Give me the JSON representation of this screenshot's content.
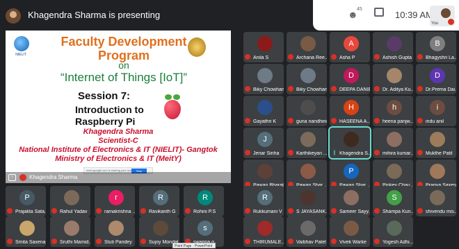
{
  "topbar": {
    "presenting": "Khagendra Sharma is presenting",
    "people_count": "45",
    "time": "10:39 AM",
    "self_label": "You"
  },
  "slide": {
    "title": "Faculty Development Program",
    "on": "on",
    "topic": "“Internet of Things [IoT]”",
    "session": "Session 7:",
    "subtitle_line1": "Introduction to",
    "subtitle_line2": "Raspberry Pi",
    "author_name": "Khagendra Sharma",
    "author_role": "Scientist-C",
    "author_org1": "National Institute of Electronics & IT (NIELIT)- Gangtok",
    "author_org2": "Ministry of Electronics & IT (MeitY)",
    "present_bar_text": "meet.google.com is sharing your screen.",
    "stop_label": "Stop sharing",
    "nielit_text": "NIELIT"
  },
  "share_footer": {
    "label": "Khagendra Sharma",
    "icon": "present-icon"
  },
  "participants": [
    {
      "name": "Anila S",
      "initial": "",
      "color": "#8b1a1a"
    },
    {
      "name": "Archana Ree...",
      "initial": "",
      "color": "#7a5a44"
    },
    {
      "name": "Asha P",
      "initial": "A",
      "color": "#e8473d"
    },
    {
      "name": "Ashish Gupta",
      "initial": "",
      "color": "#5a3b68"
    },
    {
      "name": "Bhagyshri La...",
      "initial": "B",
      "color": "#7f7f7f"
    },
    {
      "name": "Biky Chowhan",
      "initial": "",
      "color": "#6e7a86"
    },
    {
      "name": "Biky Chowhan",
      "initial": "",
      "color": "#6e7a86"
    },
    {
      "name": "DEEPA DANIEL",
      "initial": "D",
      "color": "#c2185b"
    },
    {
      "name": "Dr. Aditya Ku...",
      "initial": "",
      "color": "#a5866a"
    },
    {
      "name": "Dr.Prema Dai...",
      "initial": "D",
      "color": "#5e35b1"
    },
    {
      "name": "Gayathri K",
      "initial": "",
      "color": "#2a4f8a"
    },
    {
      "name": "guna nandhini",
      "initial": "",
      "color": "#4d4d4d"
    },
    {
      "name": "HASEENA A...",
      "initial": "H",
      "color": "#d84315"
    },
    {
      "name": "heena panjw...",
      "initial": "h",
      "color": "#6d4c41"
    },
    {
      "name": "indu anil",
      "initial": "i",
      "color": "#6d4c41"
    },
    {
      "name": "Jenar Sinha",
      "initial": "J",
      "color": "#546e7a"
    },
    {
      "name": "Karthikeyan ...",
      "initial": "",
      "color": "#7c6b5b"
    },
    {
      "name": "Khagendra S...",
      "initial": "",
      "color": "#3e2a1e"
    },
    {
      "name": "mihira kumar...",
      "initial": "",
      "color": "#8d6e63"
    },
    {
      "name": "Mukthe Patil",
      "initial": "",
      "color": "#9e7b5b"
    },
    {
      "name": "Pawan Bharat",
      "initial": "",
      "color": "#5d4037"
    },
    {
      "name": "Pawan Shar...",
      "initial": "",
      "color": "#8d5a48"
    },
    {
      "name": "Pawan Shar...",
      "initial": "P",
      "color": "#1565c0"
    },
    {
      "name": "Pinkey Chau...",
      "initial": "",
      "color": "#7a6a58"
    },
    {
      "name": "Pragya Saxena",
      "initial": "",
      "color": "#a0785a"
    },
    {
      "name": "Prajakta Sata...",
      "initial": "P",
      "color": "#455a64"
    },
    {
      "name": "Rahul Yadav",
      "initial": "",
      "color": "#7b6a5a"
    },
    {
      "name": "ramakrishna ...",
      "initial": "r",
      "color": "#e91e63"
    },
    {
      "name": "Ravikanth G",
      "initial": "R",
      "color": "#546e7a"
    },
    {
      "name": "Rohini P.S",
      "initial": "R",
      "color": "#00897b"
    },
    {
      "name": "Rukkumani V",
      "initial": "R",
      "color": "#546e7a"
    },
    {
      "name": "S JAYASANK...",
      "initial": "",
      "color": "#4e342e"
    },
    {
      "name": "Sameer Sayy...",
      "initial": "",
      "color": "#8d6e63"
    },
    {
      "name": "Shampa Kun...",
      "initial": "S",
      "color": "#43a047"
    },
    {
      "name": "shivendu mis...",
      "initial": "",
      "color": "#7a6a5a"
    },
    {
      "name": "Smita Saxena",
      "initial": "",
      "color": "#c9a66b"
    },
    {
      "name": "Sruthi Mamid...",
      "initial": "",
      "color": "#9a7b6b"
    },
    {
      "name": "Stuti Pandey",
      "initial": "",
      "color": "#ad8a6e"
    },
    {
      "name": "Sujoy Mondal",
      "initial": "",
      "color": "#5d4a3a"
    },
    {
      "name": "swapna g",
      "initial": "s",
      "color": "#546e7a"
    },
    {
      "name": "THIRUMALE...",
      "initial": "",
      "color": "#9e2a2a"
    },
    {
      "name": "Vaibhav Patel",
      "initial": "",
      "color": "#6a6a6a"
    },
    {
      "name": "Vivek Warke",
      "initial": "",
      "color": "#7b5a45"
    },
    {
      "name": "Yogesh Adhi...",
      "initial": "",
      "color": "#5a6a5a"
    }
  ],
  "tooltip": "Point Page - PowerPoint"
}
